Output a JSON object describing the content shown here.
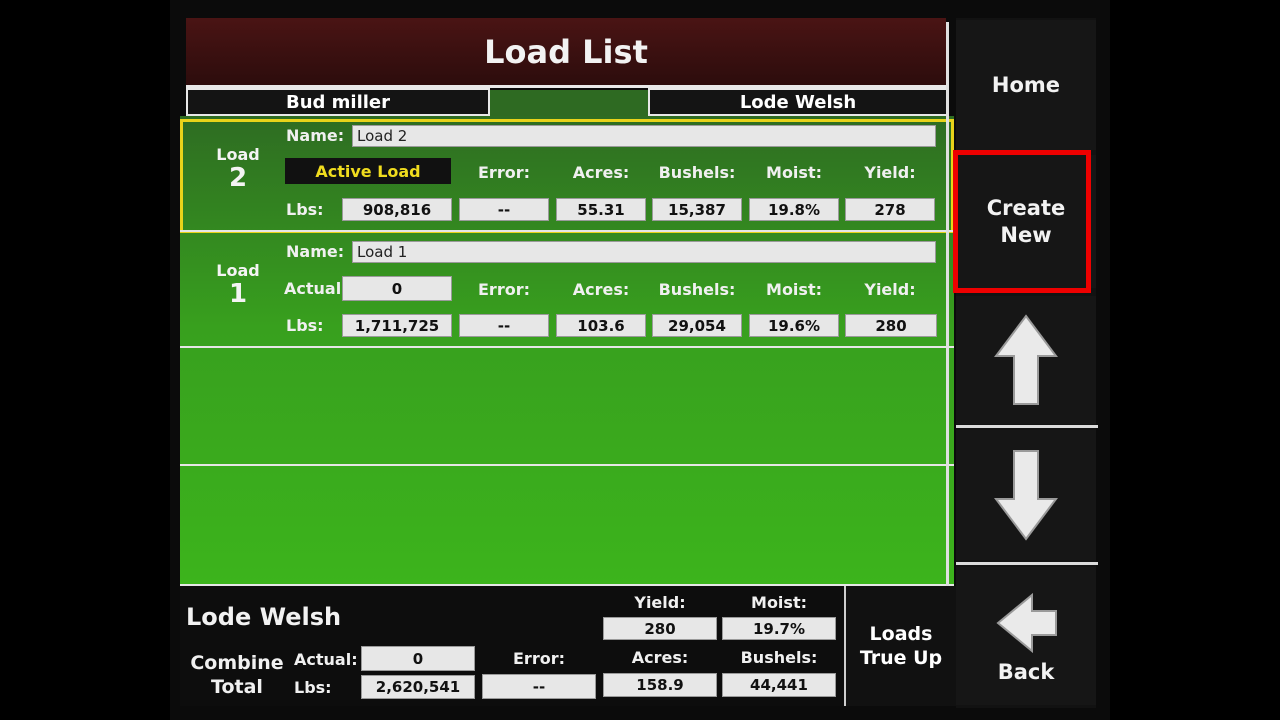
{
  "header": {
    "title": "Load List"
  },
  "subheader": {
    "left": "Bud miller",
    "right": "Lode Welsh"
  },
  "labels": {
    "name": "Name:",
    "lbs": "Lbs:",
    "actual": "Actual:",
    "error": "Error:",
    "acres": "Acres:",
    "bushels": "Bushels:",
    "moist": "Moist:",
    "yield": "Yield:",
    "load": "Load",
    "active_load": "Active Load"
  },
  "loads": [
    {
      "number": "2",
      "name": "Load 2",
      "active": true,
      "lbs": "908,816",
      "error": "--",
      "acres": "55.31",
      "bushels": "15,387",
      "moist": "19.8%",
      "yield": "278"
    },
    {
      "number": "1",
      "name": "Load 1",
      "active": false,
      "actual": "0",
      "lbs": "1,711,725",
      "error": "--",
      "acres": "103.6",
      "bushels": "29,054",
      "moist": "19.6%",
      "yield": "280"
    }
  ],
  "summary": {
    "title": "Lode Welsh",
    "combine_total_line1": "Combine",
    "combine_total_line2": "Total",
    "actual_label": "Actual:",
    "actual": "0",
    "lbs_label": "Lbs:",
    "lbs": "2,620,541",
    "error_label": "Error:",
    "error": "--",
    "yield_label": "Yield:",
    "yield": "280",
    "moist_label": "Moist:",
    "moist": "19.7%",
    "acres_label": "Acres:",
    "acres": "158.9",
    "bushels_label": "Bushels:",
    "bushels": "44,441",
    "true_up_line1": "Loads",
    "true_up_line2": "True Up"
  },
  "sidebar": {
    "home": "Home",
    "create_new_line1": "Create",
    "create_new_line2": "New",
    "up_icon": "arrow-up-icon",
    "down_icon": "arrow-down-icon",
    "back_icon": "arrow-left-icon",
    "back": "Back",
    "highlight_color": "#ee0000"
  },
  "colors": {
    "row_green": "#38a01e",
    "active_border": "#e8d31a",
    "title_bg": "#3a1010",
    "active_text": "#f0dc1e"
  }
}
